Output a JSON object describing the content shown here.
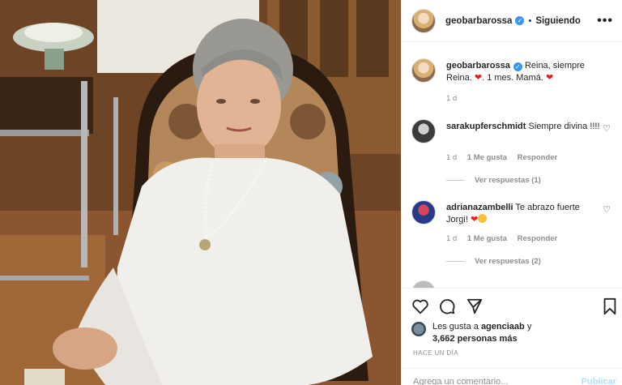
{
  "post": {
    "username": "geobarbarossa",
    "verified_mark": "✓",
    "separator": "•",
    "follow_status": "Siguiendo",
    "more_glyph": "•••",
    "photo_alt": "older-woman-in-armchair"
  },
  "caption": {
    "username": "geobarbarossa",
    "text_part1": "Reina, siempre Reina.",
    "text_part2": ". 1 mes. Mamá.",
    "heart_glyph": "❤",
    "time": "1 d"
  },
  "comments": [
    {
      "username": "sarakupferschmidt",
      "text": "Siempre divina !!!!",
      "time": "1 d",
      "likes": "1 Me gusta",
      "reply": "Responder",
      "view_replies": "Ver respuestas (1)"
    },
    {
      "username": "adrianazambelli",
      "text": "Te abrazo fuerte Jorgi!",
      "time": "1 d",
      "likes": "1 Me gusta",
      "reply": "Responder",
      "view_replies": "Ver respuestas (2)"
    }
  ],
  "like_glyph": "♡",
  "likes": {
    "prefix": "Les gusta a",
    "first_user": "agenciaab",
    "connector": "y",
    "others": "3,662 personas más"
  },
  "timestamp": "HACE UN DÍA",
  "comment_box": {
    "placeholder": "Agrega un comentario...",
    "publish": "Publicar"
  },
  "colors": {
    "accent": "#3897f0",
    "heart": "#ed1c24",
    "muted": "#8e8e8e",
    "publish_disabled": "#b2dffc"
  }
}
